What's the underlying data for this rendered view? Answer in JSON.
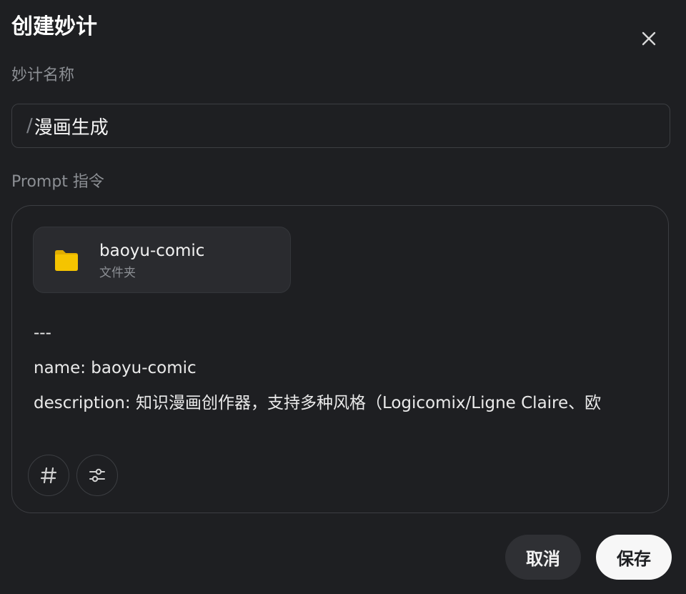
{
  "dialog": {
    "title": "创建妙计"
  },
  "form": {
    "name_label": "妙计名称",
    "name_prefix": "/",
    "name_value": "漫画生成",
    "prompt_label": "Prompt 指令"
  },
  "prompt": {
    "attachment": {
      "name": "baoyu-comic",
      "type": "文件夹",
      "icon": "folder-icon"
    },
    "lines": [
      "---",
      "name: baoyu-comic",
      "description: 知识漫画创作器，支持多种风格（Logicomix/Ligne Claire、欧"
    ],
    "tools": [
      {
        "name": "hashtag",
        "icon": "hash-icon",
        "glyph": "#"
      },
      {
        "name": "settings",
        "icon": "sliders-icon"
      }
    ]
  },
  "actions": {
    "cancel_label": "取消",
    "save_label": "保存"
  },
  "colors": {
    "background": "#1e1f22",
    "border": "#3c3e42",
    "folder": "#f5c400",
    "save_button": "#f7f7f7",
    "cancel_button": "#2f3034"
  }
}
